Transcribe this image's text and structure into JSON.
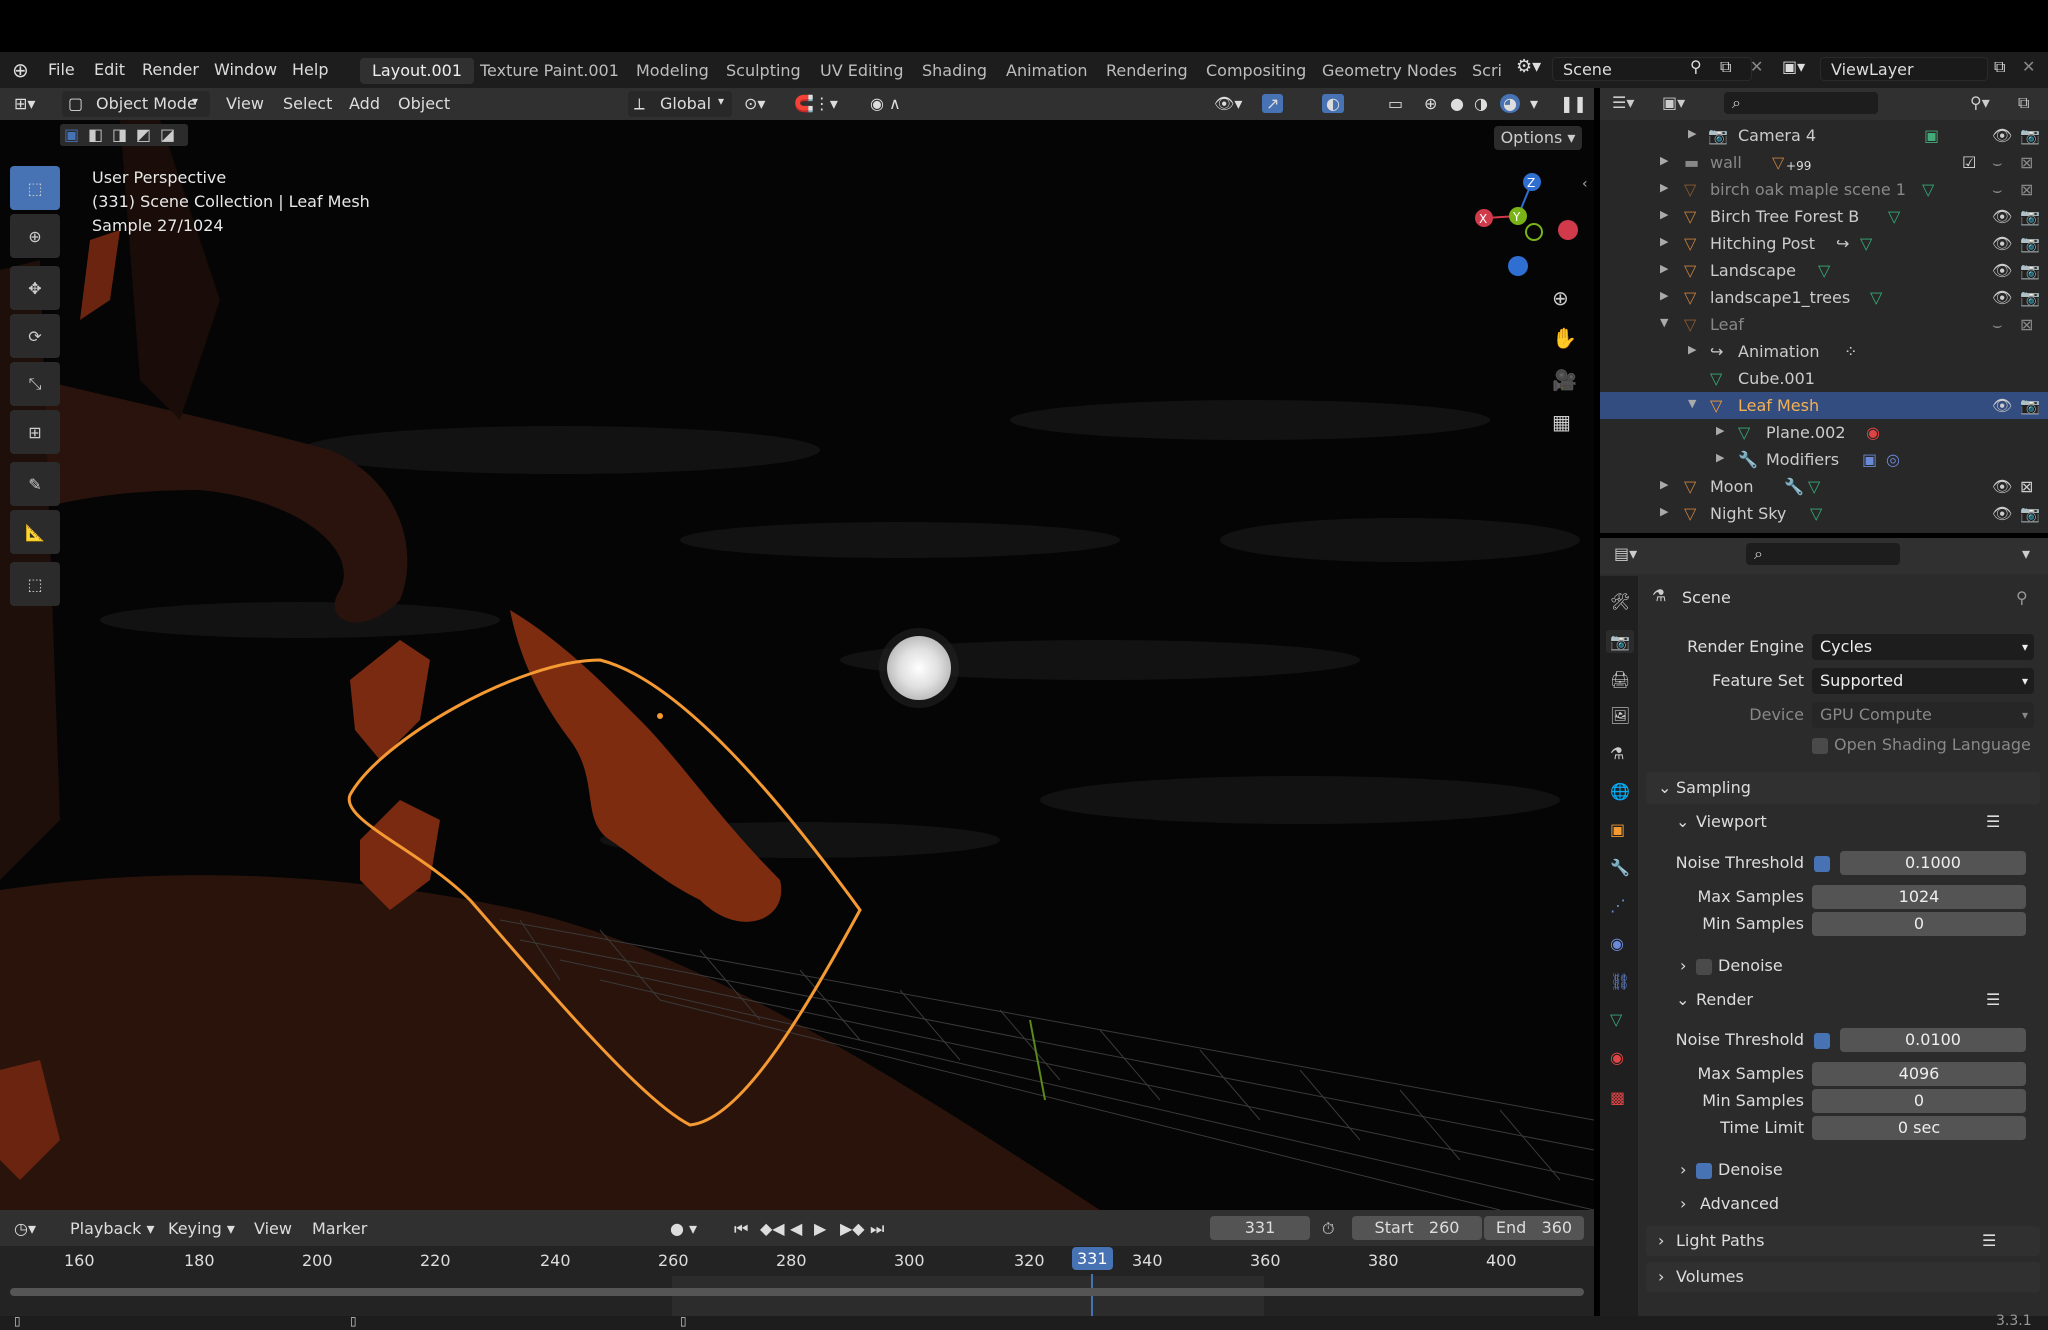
{
  "menu": [
    "File",
    "Edit",
    "Render",
    "Window",
    "Help"
  ],
  "workspaces": [
    {
      "label": "Layout.001",
      "active": true
    },
    {
      "label": "Texture Paint.001"
    },
    {
      "label": "Modeling"
    },
    {
      "label": "Sculpting"
    },
    {
      "label": "UV Editing"
    },
    {
      "label": "Shading"
    },
    {
      "label": "Animation"
    },
    {
      "label": "Rendering"
    },
    {
      "label": "Compositing"
    },
    {
      "label": "Geometry Nodes"
    },
    {
      "label": "Scri"
    }
  ],
  "scene_name": "Scene",
  "view_layer": "ViewLayer",
  "header": {
    "mode": "Object Mode",
    "menus": [
      "View",
      "Select",
      "Add",
      "Object"
    ],
    "orientation": "Global",
    "options": "Options"
  },
  "overlay": {
    "line1": "User Perspective",
    "line2": "(331) Scene Collection | Leaf Mesh",
    "line3": "Sample 27/1024"
  },
  "gizmo": {
    "x": "X",
    "y": "Y",
    "z": "Z"
  },
  "timeline": {
    "menus": [
      "Playback",
      "Keying",
      "View",
      "Marker"
    ],
    "current_frame": "331",
    "start_label": "Start",
    "start": "260",
    "end_label": "End",
    "end": "360",
    "ticks": [
      "160",
      "180",
      "200",
      "220",
      "240",
      "260",
      "280",
      "300",
      "320",
      "331",
      "340",
      "360",
      "380",
      "400"
    ]
  },
  "outliner": [
    {
      "name": "Camera 4",
      "depth": 1
    },
    {
      "name": "wall",
      "depth": 0,
      "badge": "99"
    },
    {
      "name": "birch oak maple scene 1",
      "depth": 0
    },
    {
      "name": "Birch Tree Forest B",
      "depth": 0
    },
    {
      "name": "Hitching Post",
      "depth": 0
    },
    {
      "name": "Landscape",
      "depth": 0
    },
    {
      "name": "landscape1_trees",
      "depth": 0
    },
    {
      "name": "Leaf",
      "depth": 0
    },
    {
      "name": "Animation",
      "depth": 1
    },
    {
      "name": "Cube.001",
      "depth": 1
    },
    {
      "name": "Leaf Mesh",
      "depth": 1,
      "selected": true
    },
    {
      "name": "Plane.002",
      "depth": 2
    },
    {
      "name": "Modifiers",
      "depth": 2
    },
    {
      "name": "Moon",
      "depth": 0
    },
    {
      "name": "Night Sky",
      "depth": 0
    }
  ],
  "properties": {
    "context": "Scene",
    "render_engine_label": "Render Engine",
    "render_engine": "Cycles",
    "feature_set_label": "Feature Set",
    "feature_set": "Supported",
    "device_label": "Device",
    "device": "GPU Compute",
    "osl_label": "Open Shading Language",
    "sampling": "Sampling",
    "viewport": "Viewport",
    "vp_noise_label": "Noise Threshold",
    "vp_noise": "0.1000",
    "vp_max_label": "Max Samples",
    "vp_max": "1024",
    "vp_min_label": "Min Samples",
    "vp_min": "0",
    "denoise_label": "Denoise",
    "render": "Render",
    "r_noise_label": "Noise Threshold",
    "r_noise": "0.0100",
    "r_max_label": "Max Samples",
    "r_max": "4096",
    "r_min_label": "Min Samples",
    "r_min": "0",
    "time_limit_label": "Time Limit",
    "time_limit": "0 sec",
    "denoise2_label": "Denoise",
    "advanced": "Advanced",
    "light_paths": "Light Paths",
    "volumes": "Volumes"
  },
  "version": "3.3.1",
  "colors": {
    "accent": "#4772b3",
    "selection": "#f59a32",
    "outliner_selected": "#334d80"
  }
}
